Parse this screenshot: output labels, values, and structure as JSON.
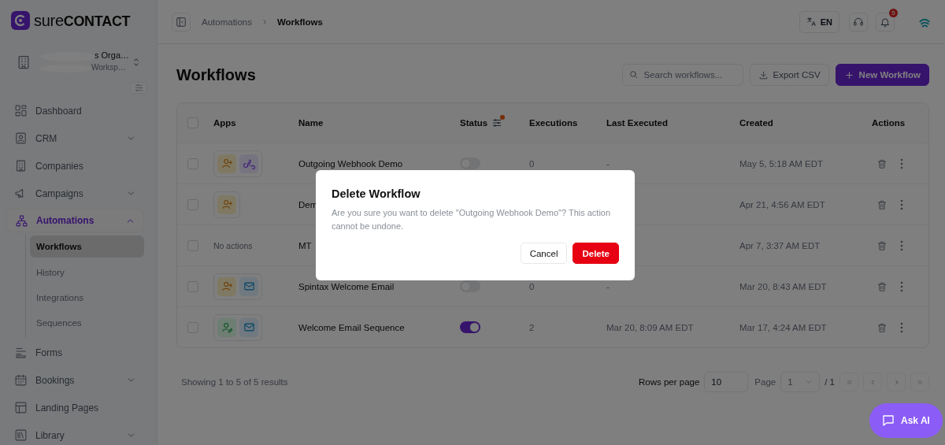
{
  "brand": {
    "name": "sure**CONTACT**"
  },
  "workspace": {
    "name": "s Orga…",
    "subtitle": "Worksp…"
  },
  "sidebar": {
    "items": [
      {
        "label": "Dashboard",
        "kind": "link",
        "selected": false
      },
      {
        "label": "CRM",
        "kind": "group",
        "expanded": false,
        "selected": false
      },
      {
        "label": "Companies",
        "kind": "link",
        "selected": false
      },
      {
        "label": "Campaigns",
        "kind": "group",
        "expanded": false,
        "selected": false
      },
      {
        "label": "Automations",
        "kind": "group",
        "expanded": true,
        "selected": true,
        "children": [
          {
            "label": "Workflows",
            "selected": true
          },
          {
            "label": "History",
            "selected": false
          },
          {
            "label": "Integrations",
            "selected": false
          },
          {
            "label": "Sequences",
            "selected": false
          }
        ]
      },
      {
        "label": "Forms",
        "kind": "link",
        "selected": false
      },
      {
        "label": "Bookings",
        "kind": "group",
        "expanded": false,
        "selected": false
      },
      {
        "label": "Landing Pages",
        "kind": "link",
        "selected": false
      },
      {
        "label": "Library",
        "kind": "group",
        "expanded": false,
        "selected": false
      }
    ]
  },
  "topbar": {
    "breadcrumb": [
      "Automations",
      "Workflows"
    ],
    "language": "EN",
    "notification_count": "5"
  },
  "page": {
    "title": "Workflows",
    "search": {
      "placeholder": "Search workflows..."
    },
    "export_label": "Export CSV",
    "new_label": "New Workflow"
  },
  "table": {
    "select_all": {
      "checked": false
    },
    "status_filter_active": true,
    "columns": [
      "Apps",
      "Name",
      "Status",
      "Executions",
      "Last Executed",
      "Created",
      "Actions"
    ],
    "rows": [
      {
        "checked": false,
        "apps": [
          {
            "kind": "contact-add"
          },
          {
            "kind": "webhook"
          }
        ],
        "name": "Outgoing Webhook Demo",
        "on": false,
        "executions": "0",
        "last_executed": "-",
        "created": "May 5, 5:18 AM EDT"
      },
      {
        "checked": false,
        "apps": [
          {
            "kind": "contact-add"
          }
        ],
        "name": "Dem",
        "created": "Apr 21, 4:56 AM EDT"
      },
      {
        "checked": false,
        "apps_text": "No actions",
        "name": "MT",
        "created": "Apr 7, 3:37 AM EDT"
      },
      {
        "checked": false,
        "apps": [
          {
            "kind": "contact-add"
          },
          {
            "kind": "email"
          }
        ],
        "name": "Spintax Welcome Email",
        "on": false,
        "executions": "0",
        "last_executed": "-",
        "created": "Mar 20, 8:43 AM EDT"
      },
      {
        "checked": false,
        "apps": [
          {
            "kind": "contact-edit"
          },
          {
            "kind": "email"
          }
        ],
        "name": "Welcome Email Sequence",
        "on": true,
        "executions": "2",
        "last_executed": "Mar 20, 8:09 AM EDT",
        "created": "Mar 17, 4:24 AM EDT"
      }
    ]
  },
  "pagination": {
    "summary": "Showing 1 to 5 of 5 results",
    "rows_per_page_label": "Rows per page",
    "rows_per_page": "10",
    "page_label": "Page",
    "page": "1",
    "page_total": "/ 1"
  },
  "dialog": {
    "title": "Delete Workflow",
    "message": "Are you sure you want to delete \"Outgoing Webhook Demo\"? This action cannot be undone.",
    "cancel_label": "Cancel",
    "delete_label": "Delete"
  },
  "ask_ai": {
    "label": "Ask AI"
  }
}
